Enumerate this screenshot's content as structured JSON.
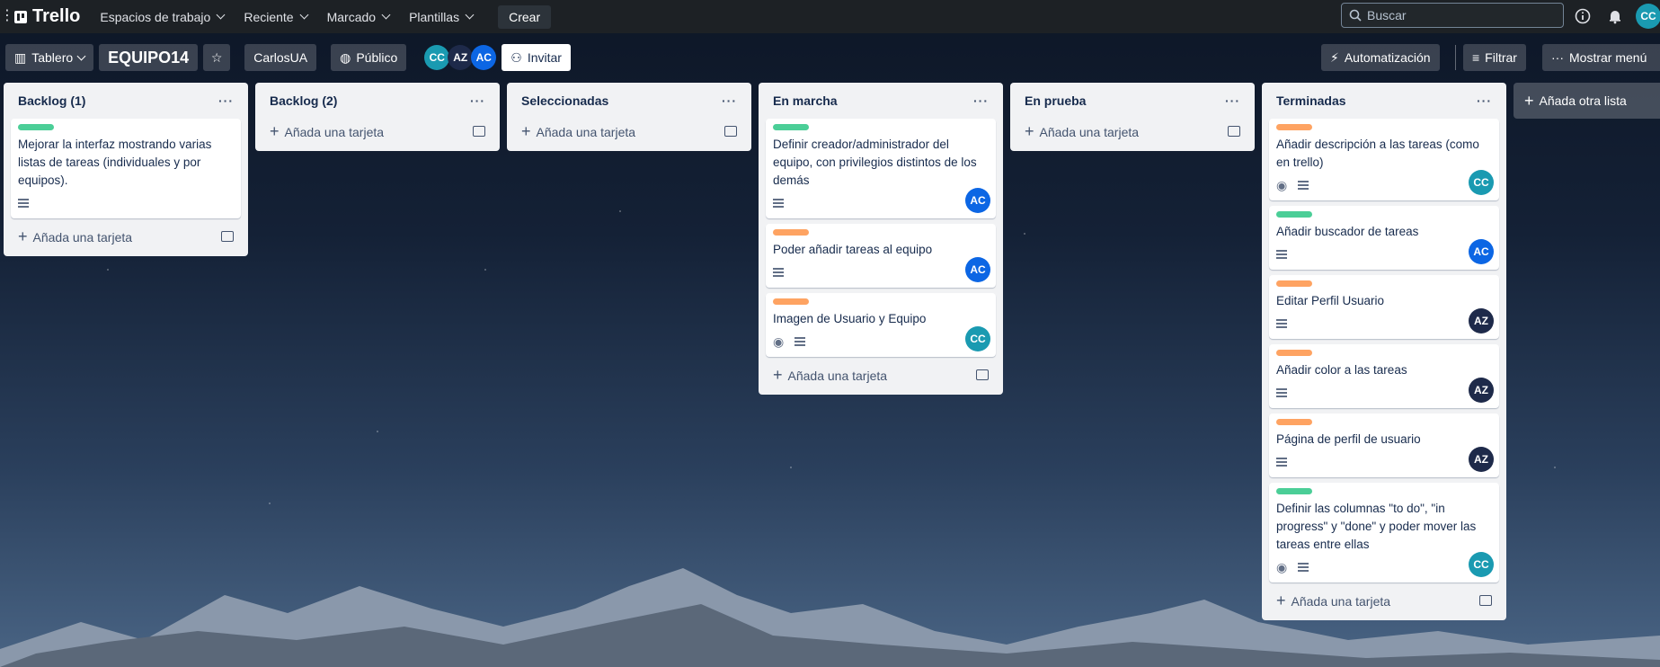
{
  "topbar": {
    "logo": "Trello",
    "nav": [
      "Espacios de trabajo",
      "Reciente",
      "Marcado",
      "Plantillas"
    ],
    "create": "Crear",
    "search_placeholder": "Buscar",
    "user_initials": "CC"
  },
  "board": {
    "view": "Tablero",
    "title": "EQUIPO14",
    "workspace": "CarlosUA",
    "visibility": "Público",
    "members": [
      "CC",
      "AZ",
      "AC"
    ],
    "invite": "Invitar",
    "automation": "Automatización",
    "filter": "Filtrar",
    "menu": "Mostrar menú",
    "add_list": "Añada otra lista",
    "add_card": "Añada una tarjeta"
  },
  "lists": [
    {
      "title": "Backlog (1)",
      "cards": [
        {
          "label": "green",
          "text": "Mejorar la interfaz mostrando varias listas de tareas (individuales y por equipos).",
          "desc": true,
          "watch": false,
          "member": ""
        }
      ]
    },
    {
      "title": "Backlog (2)",
      "cards": []
    },
    {
      "title": "Seleccionadas",
      "cards": []
    },
    {
      "title": "En marcha",
      "cards": [
        {
          "label": "green",
          "text": "Definir creador/administrador del equipo, con privilegios distintos de los demás",
          "desc": true,
          "watch": false,
          "member": "AC"
        },
        {
          "label": "orange",
          "text": "Poder añadir tareas al equipo",
          "desc": true,
          "watch": false,
          "member": "AC"
        },
        {
          "label": "orange",
          "text": "Imagen de Usuario y Equipo",
          "desc": true,
          "watch": true,
          "member": "CC"
        }
      ]
    },
    {
      "title": "En prueba",
      "cards": []
    },
    {
      "title": "Terminadas",
      "cards": [
        {
          "label": "orange",
          "text": "Añadir descripción a las tareas (como en trello)",
          "desc": true,
          "watch": true,
          "member": "CC"
        },
        {
          "label": "green",
          "text": "Añadir buscador de tareas",
          "desc": true,
          "watch": false,
          "member": "AC"
        },
        {
          "label": "orange",
          "text": "Editar Perfil Usuario",
          "desc": true,
          "watch": false,
          "member": "AZ"
        },
        {
          "label": "orange",
          "text": "Añadir color a las tareas",
          "desc": true,
          "watch": false,
          "member": "AZ"
        },
        {
          "label": "orange",
          "text": "Página de perfil de usuario",
          "desc": true,
          "watch": false,
          "member": "AZ"
        },
        {
          "label": "green",
          "text": "Definir las columnas \"to do\", \"in progress\" y \"done\" y poder mover las tareas entre ellas",
          "desc": true,
          "watch": true,
          "member": "CC"
        }
      ]
    }
  ]
}
